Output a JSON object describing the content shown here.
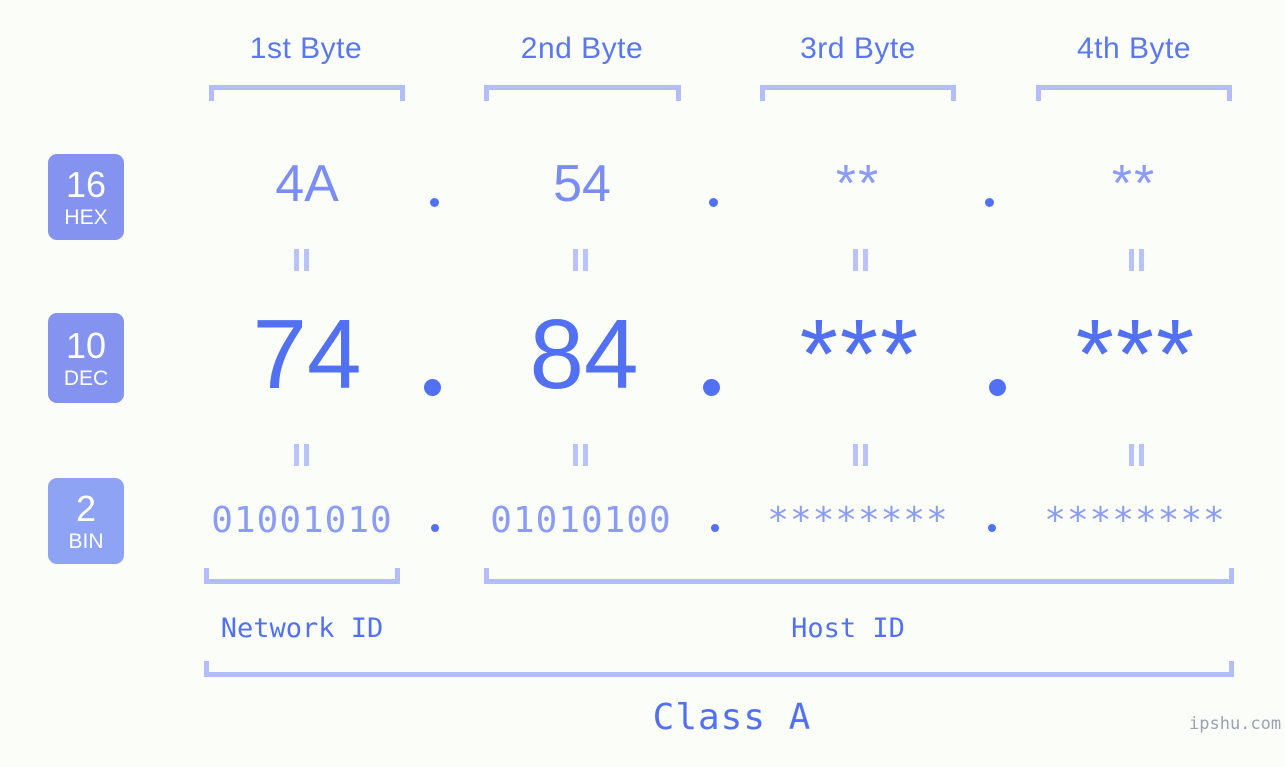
{
  "meta": {
    "background_color": "#fbfdf8",
    "accent_strong": "#5271f2",
    "accent_light": "#8b9cf6",
    "bracket_color": "#b2bdfa",
    "badge_color_hex": "#8492f0",
    "badge_color_dec": "#8492f0",
    "badge_color_bin": "#8fa3f5"
  },
  "headers": {
    "byte1": "1st Byte",
    "byte2": "2nd Byte",
    "byte3": "3rd Byte",
    "byte4": "4th Byte"
  },
  "rows": [
    {
      "id": "hex",
      "badge_num": "16",
      "badge_name": "HEX",
      "values": [
        "4A",
        "54",
        "**",
        "**"
      ],
      "separator": "."
    },
    {
      "id": "dec",
      "badge_num": "10",
      "badge_name": "DEC",
      "values": [
        "74",
        "84",
        "***",
        "***"
      ],
      "separator": "."
    },
    {
      "id": "bin",
      "badge_num": "2",
      "badge_name": "BIN",
      "values": [
        "01001010",
        "01010100",
        "********",
        "********"
      ],
      "separator": "."
    }
  ],
  "equals_symbol": "=",
  "zones": {
    "network_id": "Network ID",
    "host_id": "Host ID"
  },
  "class": {
    "label": "Class A"
  },
  "watermark": "ipshu.com"
}
